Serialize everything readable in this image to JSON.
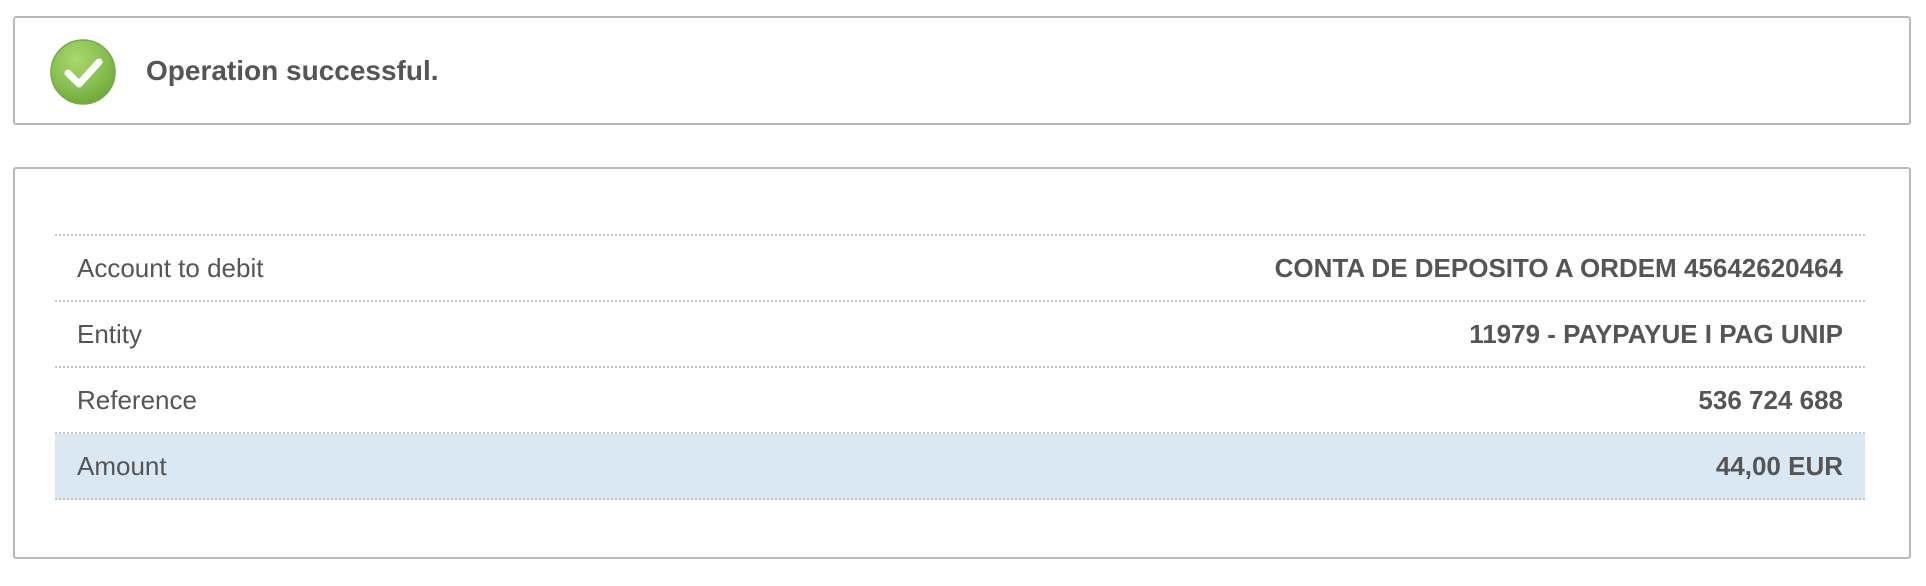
{
  "notification": {
    "message": "Operation successful.",
    "icon": "check-circle-icon",
    "icon_color": "#7ab648"
  },
  "details": {
    "rows": [
      {
        "label": "Account to debit",
        "value": "CONTA DE DEPOSITO A ORDEM 45642620464"
      },
      {
        "label": "Entity",
        "value": "11979 - PAYPAYUE I PAG UNIP"
      },
      {
        "label": "Reference",
        "value": "536 724 688"
      },
      {
        "label": "Amount",
        "value": "44,00 EUR",
        "highlighted": true
      }
    ],
    "highlight_color": "#d9e8f3"
  }
}
